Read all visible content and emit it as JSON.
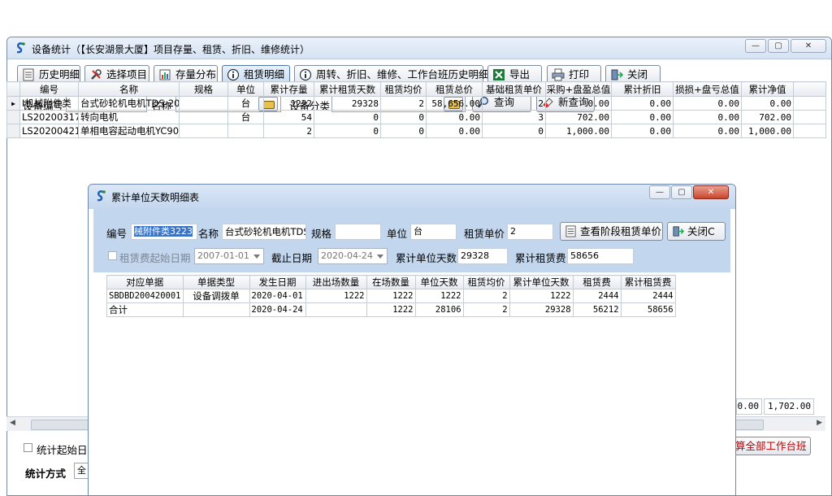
{
  "main": {
    "title": "设备统计（【长安湖景大厦】项目存量、租赁、折旧、维修统计）",
    "window_controls": {
      "minimize": "—",
      "maximize": "▢",
      "close": "✕"
    },
    "toolbar": [
      {
        "label": "历史明细",
        "icon": "list-icon"
      },
      {
        "label": "选择项目",
        "icon": "tools-icon"
      },
      {
        "label": "存量分布",
        "icon": "chart-icon"
      },
      {
        "label": "租赁明细",
        "icon": "info-icon"
      },
      {
        "label": "周转、折旧、维修、工作台班历史明细",
        "icon": "info-icon"
      },
      {
        "label": "导出",
        "icon": "excel-icon"
      },
      {
        "label": "打印",
        "icon": "printer-icon"
      },
      {
        "label": "关闭",
        "icon": "exit-icon"
      }
    ],
    "filters": {
      "device_code_label": "设备编号",
      "name_label": "名称",
      "category_label": "设备分类",
      "query_label": "查询",
      "new_query_label": "新查询"
    },
    "table": {
      "headers": [
        "编号",
        "名称",
        "规格",
        "单位",
        "累计存量",
        "累计租赁天数",
        "租赁均价",
        "租赁总价",
        "基础租赁单价",
        "采购+盘盈总值",
        "累计折旧",
        "损损+盘亏总值",
        "累计净值"
      ],
      "rows": [
        {
          "indicator": "▶",
          "cells": [
            "I机械附件类",
            "台式砂轮机电机TDS-200",
            "",
            "台",
            "1222",
            "29328",
            "2",
            "58,656.00",
            "2",
            "0.00",
            "0.00",
            "0.00",
            "0.00"
          ]
        },
        {
          "indicator": "",
          "cells": [
            "LS202003171",
            "转向电机",
            "",
            "台",
            "54",
            "0",
            "0",
            "0.00",
            "3",
            "702.00",
            "0.00",
            "0.00",
            "702.00"
          ]
        },
        {
          "indicator": "",
          "cells": [
            "LS202004211",
            "单相电容起动电机YC90",
            "",
            "",
            "2",
            "0",
            "0",
            "0.00",
            "0",
            "1,000.00",
            "0.00",
            "0.00",
            "1,000.00"
          ]
        }
      ],
      "summary": [
        "0.00",
        "1,702.00"
      ]
    },
    "bottom": {
      "stat_start_label": "统计起始日",
      "stat_method_label": "统计方式",
      "stat_method_value": "全",
      "calc_all_label": "算全部工作台班"
    }
  },
  "dialog": {
    "title": "累计单位天数明细表",
    "fields": {
      "code_label": "编号",
      "code_value": "械附件类3223",
      "name_label": "名称",
      "name_value": "台式砂轮机电机TDS",
      "spec_label": "规格",
      "spec_value": "",
      "unit_label": "单位",
      "unit_value": "台",
      "price_label": "租赁单价",
      "price_value": "2",
      "start_label": "租赁费起始日期",
      "start_value": "2007-01-01",
      "end_label": "截止日期",
      "end_value": "2020-04-24",
      "days_label": "累计单位天数",
      "days_value": "29328",
      "fee_label": "累计租赁费",
      "fee_value": "58656"
    },
    "buttons": {
      "view_price": "查看阶段租赁单价",
      "close": "关闭C"
    },
    "table": {
      "headers": [
        "对应单据",
        "单据类型",
        "发生日期",
        "进出场数量",
        "在场数量",
        "单位天数",
        "租赁均价",
        "累计单位天数",
        "租赁费",
        "累计租赁费"
      ],
      "rows": [
        [
          "SBDBD200420001",
          "设备调拨单",
          "2020-04-01",
          "1222",
          "1222",
          "1222",
          "2",
          "1222",
          "2444",
          "2444"
        ],
        [
          "合计",
          "",
          "2020-04-24",
          "",
          "1222",
          "28106",
          "2",
          "29328",
          "56212",
          "58656"
        ]
      ]
    }
  }
}
